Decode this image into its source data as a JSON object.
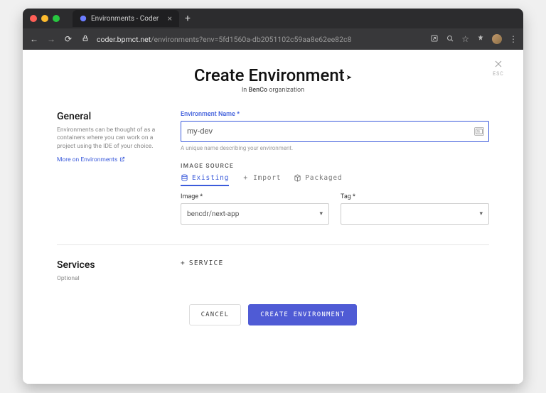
{
  "browser": {
    "tab_title": "Environments - Coder",
    "url_host": "coder.bpmct.net",
    "url_path": "/environments?env=5fd1560a-db2051102c59aa8e62ee82c8"
  },
  "modal": {
    "title": "Create Environment",
    "subtitle_prefix": "In ",
    "subtitle_org": "BenCo",
    "subtitle_suffix": " organization",
    "esc_label": "ESC"
  },
  "general": {
    "heading": "General",
    "description": "Environments can be thought of as a containers where you can work on a project using the IDE of your choice.",
    "link_label": "More on Environments"
  },
  "env_name": {
    "label": "Environment Name *",
    "value": "my-dev",
    "helper": "A unique name describing your environment."
  },
  "image_source": {
    "section_label": "IMAGE SOURCE",
    "tabs": {
      "existing": "Existing",
      "import": "Import",
      "packaged": "Packaged"
    },
    "image_label": "Image *",
    "image_value": "bencdr/next-app",
    "tag_label": "Tag *",
    "tag_value": ""
  },
  "services": {
    "heading": "Services",
    "subheading": "Optional",
    "add_label": "SERVICE"
  },
  "actions": {
    "cancel": "CANCEL",
    "create": "CREATE ENVIRONMENT"
  }
}
